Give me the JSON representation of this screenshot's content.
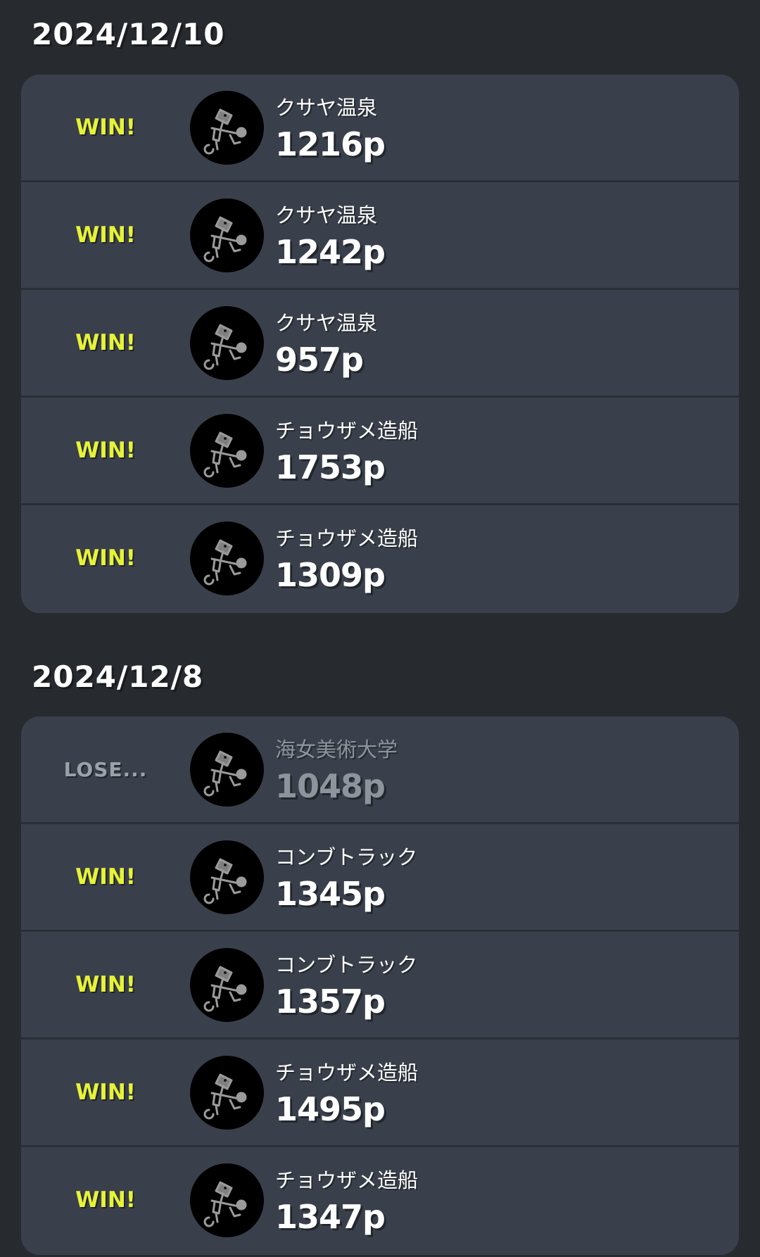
{
  "groups": [
    {
      "date": "2024/12/10",
      "battles": [
        {
          "result": "WIN!",
          "stage": "クサヤ温泉",
          "points": "1216p",
          "weapon_icon": "airbrush-weapon-icon"
        },
        {
          "result": "WIN!",
          "stage": "クサヤ温泉",
          "points": "1242p",
          "weapon_icon": "airbrush-weapon-icon"
        },
        {
          "result": "WIN!",
          "stage": "クサヤ温泉",
          "points": "957p",
          "weapon_icon": "airbrush-weapon-icon"
        },
        {
          "result": "WIN!",
          "stage": "チョウザメ造船",
          "points": "1753p",
          "weapon_icon": "airbrush-weapon-icon"
        },
        {
          "result": "WIN!",
          "stage": "チョウザメ造船",
          "points": "1309p",
          "weapon_icon": "airbrush-weapon-icon"
        }
      ]
    },
    {
      "date": "2024/12/8",
      "battles": [
        {
          "result": "LOSE...",
          "stage": "海女美術大学",
          "points": "1048p",
          "weapon_icon": "airbrush-weapon-icon"
        },
        {
          "result": "WIN!",
          "stage": "コンブトラック",
          "points": "1345p",
          "weapon_icon": "airbrush-weapon-icon"
        },
        {
          "result": "WIN!",
          "stage": "コンブトラック",
          "points": "1357p",
          "weapon_icon": "airbrush-weapon-icon"
        },
        {
          "result": "WIN!",
          "stage": "チョウザメ造船",
          "points": "1495p",
          "weapon_icon": "airbrush-weapon-icon"
        },
        {
          "result": "WIN!",
          "stage": "チョウザメ造船",
          "points": "1347p",
          "weapon_icon": "airbrush-weapon-icon"
        }
      ]
    }
  ],
  "colors": {
    "background": "#272a2f",
    "card": "#3a404b",
    "win": "#e6f337",
    "lose": "#9aa1a8",
    "lose_text": "#8d949b"
  }
}
